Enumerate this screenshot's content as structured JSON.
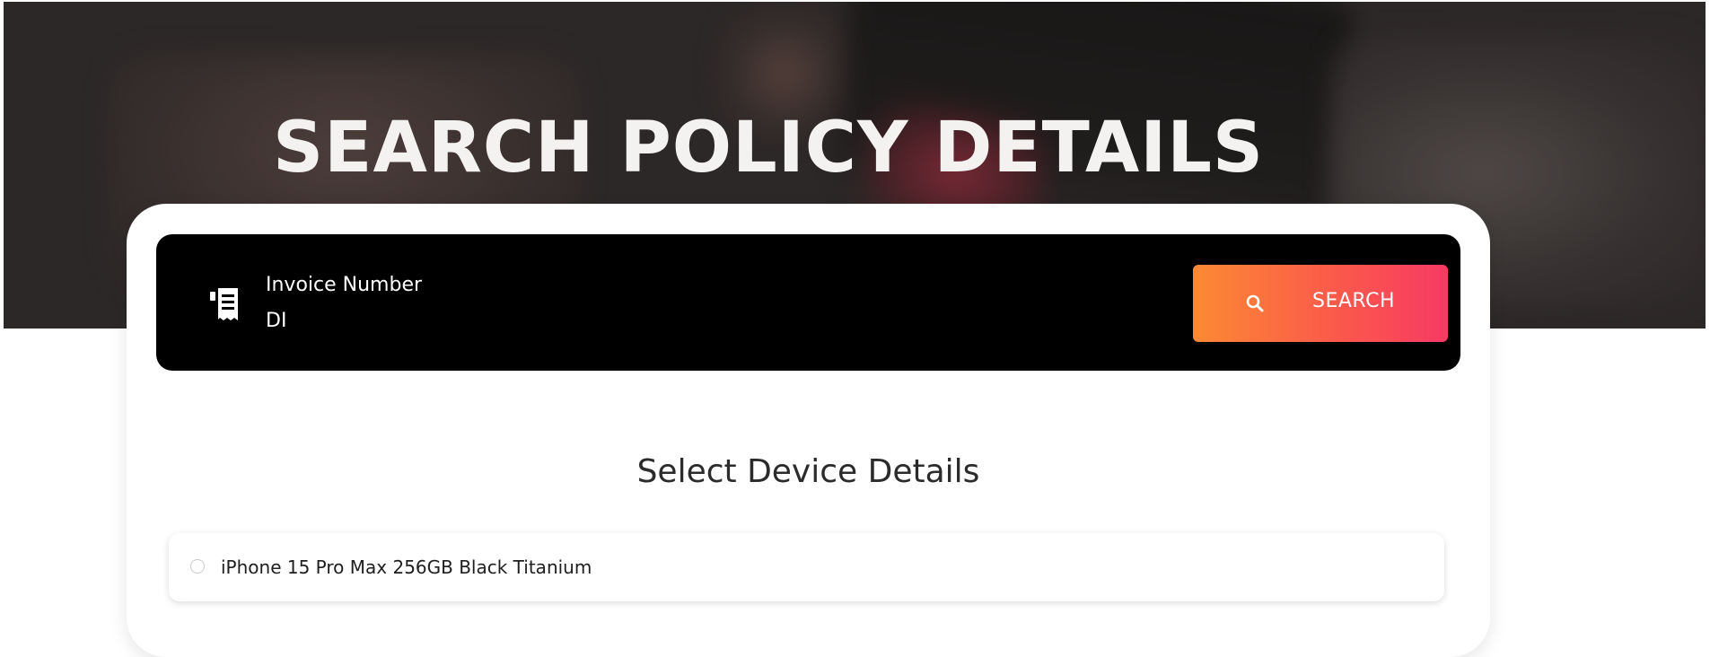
{
  "hero": {
    "title": "SEARCH POLICY DETAILS"
  },
  "search": {
    "invoice_icon": "receipt-icon",
    "invoice_label": "Invoice Number",
    "invoice_value": "DI",
    "button_icon": "search-icon",
    "button_label": "SEARCH"
  },
  "devices": {
    "title": "Select Device Details",
    "options": [
      {
        "label": "iPhone 15 Pro Max 256GB Black Titanium",
        "selected": false
      }
    ]
  },
  "colors": {
    "button_gradient_start": "#fb8a33",
    "button_gradient_end": "#f73a63",
    "search_bar": "#000000"
  }
}
